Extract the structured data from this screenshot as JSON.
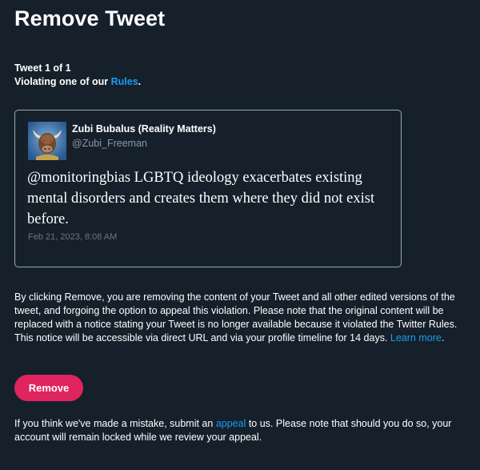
{
  "header": {
    "title": "Remove Tweet"
  },
  "meta": {
    "counter": "Tweet 1 of 1",
    "violation_prefix": "Violating one of our ",
    "rules_link": "Rules",
    "violation_suffix": "."
  },
  "tweet": {
    "author_name": "Zubi Bubalus (Reality Matters)",
    "author_handle": "@Zubi_Freeman",
    "text": "@monitoringbias LGBTQ ideology exacerbates existing mental disorders and creates them where they did not exist before.",
    "date": "Feb 21, 2023, 8:08 AM",
    "avatar_icon": "bull-mascot-avatar"
  },
  "notice": {
    "body": "By clicking Remove, you are removing the content of your Tweet and all other edited versions of the tweet, and forgoing the option to appeal this violation. Please note that the original content will be replaced with a notice stating your Tweet is no longer available because it violated the Twitter Rules. This notice will be accessible via direct URL and via your profile timeline for 14 days. ",
    "learn_more": "Learn more",
    "end": "."
  },
  "actions": {
    "remove_label": "Remove"
  },
  "appeal": {
    "prefix": "If you think we've made a mistake, submit an ",
    "link": "appeal",
    "suffix": " to us. Please note that should you do so, your account will remain locked while we review your appeal."
  },
  "colors": {
    "background": "#15202b",
    "accent_link": "#1d9bf0",
    "remove_button": "#e0245e",
    "secondary_text": "#8b98a5",
    "card_border": "#9aa8b3"
  }
}
